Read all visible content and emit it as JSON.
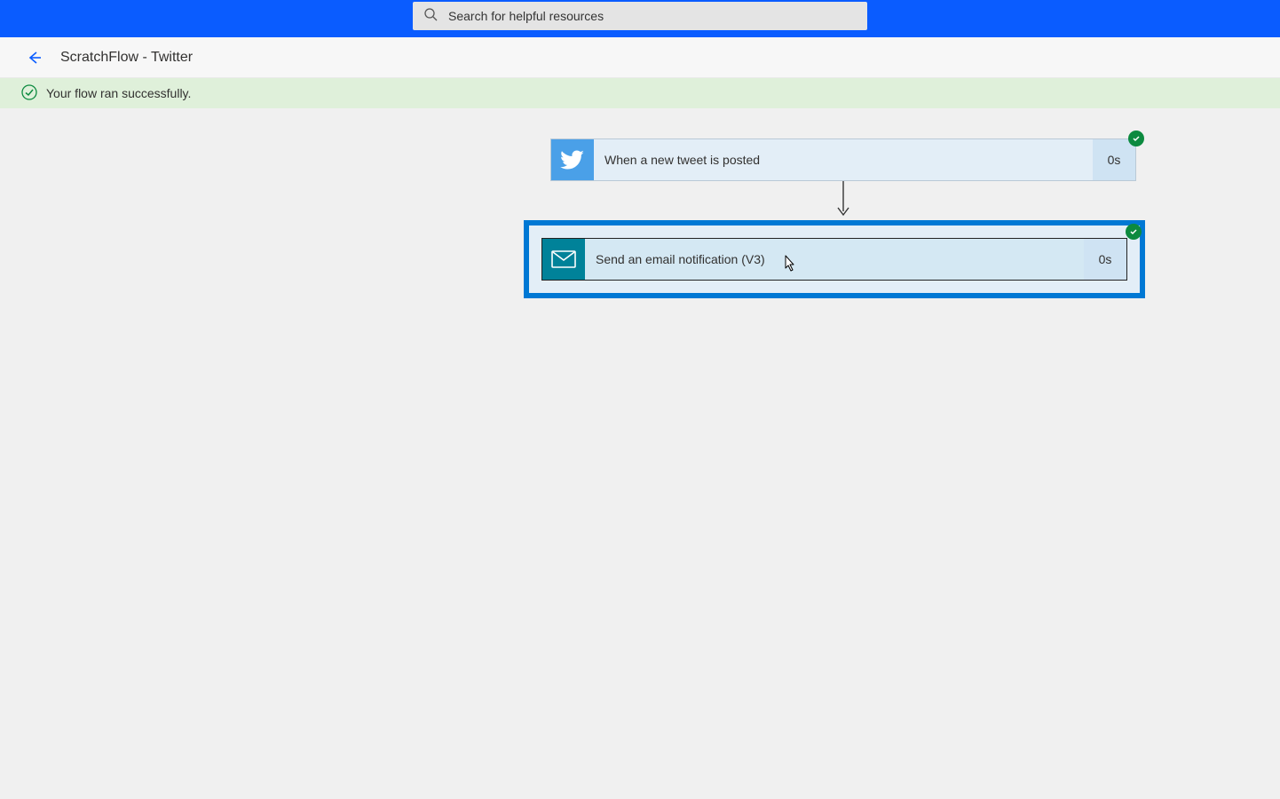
{
  "topbar": {
    "search_placeholder": "Search for helpful resources"
  },
  "header": {
    "title": "ScratchFlow - Twitter"
  },
  "banner": {
    "message": "Your flow ran successfully."
  },
  "flow": {
    "steps": [
      {
        "label": "When a new tweet is posted",
        "duration": "0s",
        "icon": "twitter-icon"
      },
      {
        "label": "Send an email notification (V3)",
        "duration": "0s",
        "icon": "mail-icon"
      }
    ]
  }
}
